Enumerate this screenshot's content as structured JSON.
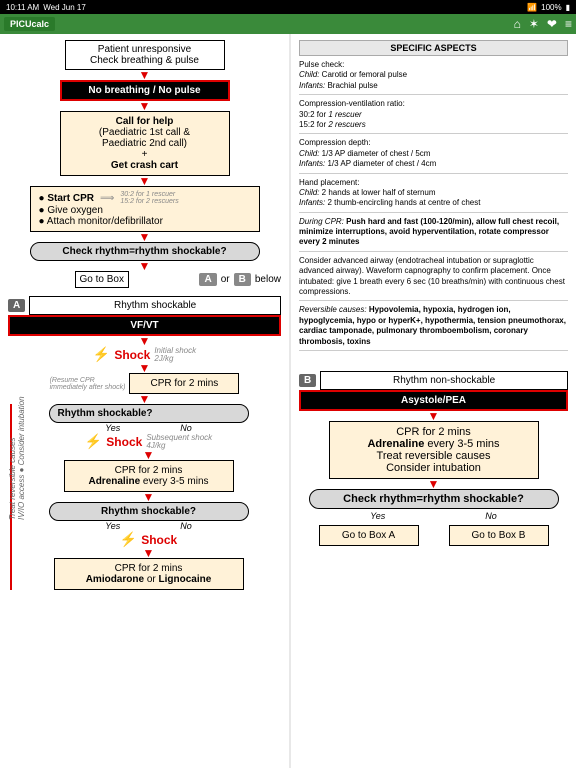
{
  "status": {
    "time": "10:11 AM",
    "date": "Wed Jun 17",
    "battery": "100%"
  },
  "app": {
    "name": "PICUcalc"
  },
  "flow": {
    "step1": "Patient unresponsive\nCheck breathing & pulse",
    "step2": "No breathing / No pulse",
    "step3_title": "Call for help",
    "step3_sub": "(Paediatric 1st call &\nPaediatric 2nd call)\n+",
    "step3_cart": "Get crash cart",
    "cpr_start": "Start CPR",
    "cpr_ratio": "30:2 for 1 rescuer\n15:2 for 2 rescuers",
    "cpr_o2": "Give oxygen",
    "cpr_mon": "Attach monitor/defibrillator",
    "check_rhythm": "Check rhythm=rhythm shockable?",
    "goto": "Go to Box",
    "or": "or",
    "below": "below",
    "A": "A",
    "B": "B"
  },
  "boxA": {
    "title": "Rhythm shockable",
    "black": "VF/VT",
    "shock": "Shock",
    "initial": "Initial shock\n2J/kg",
    "cpr2": "CPR for 2 mins",
    "resume": "(Resume CPR\nimmediately after shock)",
    "rs": "Rhythm shockable?",
    "yes": "Yes",
    "no": "No",
    "subsequent": "Subsequent shock\n4J/kg",
    "cpr_adr": "CPR for 2 mins",
    "adr": "Adrenaline",
    "adr_t": " every 3-5 mins",
    "cpr_amio": "CPR for 2 mins",
    "amio": "Amiodarone",
    "lig": "Lignocaine",
    "or": " or ",
    "sidev": "Treat reversible causes\nIV/IO access ● Consider intubation"
  },
  "boxB": {
    "title": "Rhythm non-shockable",
    "black": "Asystole/PEA",
    "l1": "CPR for 2 mins",
    "l2a": "Adrenaline",
    "l2b": " every 3-5 mins",
    "l3": "Treat reversible causes",
    "l4": "Consider intubation",
    "check": "Check rhythm=rhythm shockable?",
    "yes": "Yes",
    "no": "No",
    "gotoA": "Go to Box A",
    "gotoB": "Go to Box B"
  },
  "aspects": {
    "title": "SPECIFIC ASPECTS",
    "p1": "Pulse check:",
    "p1a": "Child:",
    "p1av": " Carotid or femoral pulse",
    "p1b": "Infants:",
    "p1bv": " Brachial pulse",
    "p2": "Compression-ventilation ratio:",
    "p2a": "30:2 for ",
    "p2ai": "1 rescuer",
    "p2b": "15:2 for ",
    "p2bi": "2 rescuers",
    "p3": "Compression depth:",
    "p3a": "Child:",
    "p3av": " 1/3 AP diameter of chest / 5cm",
    "p3b": "Infants:",
    "p3bv": " 1/3 AP diameter of chest / 4cm",
    "p4": "Hand placement:",
    "p4a": "Child:",
    "p4av": " 2 hands at lower half of sternum",
    "p4b": "Infants:",
    "p4bv": " 2 thumb-encircling hands at centre of chest",
    "p5a": "During CPR:",
    "p5b": " Push hard and fast (100-120/min), allow full chest recoil, minimize interruptions, avoid hyperventilation, rotate compressor every 2 minutes",
    "p6": "Consider advanced airway (endotracheal intubation or supraglottic advanced airway). Waveform capnography to confirm placement. Once intubated: give 1 breath every 6 sec (10 breaths/min) with continuous chest compressions.",
    "p7a": "Reversible causes:",
    "p7b": " Hypovolemia, hypoxia, hydrogen ion, hypoglycemia, hypo or hyperK+, hypothermia, tension pneumothorax, cardiac tamponade, pulmonary thromboembolism, coronary thrombosis, toxins"
  }
}
